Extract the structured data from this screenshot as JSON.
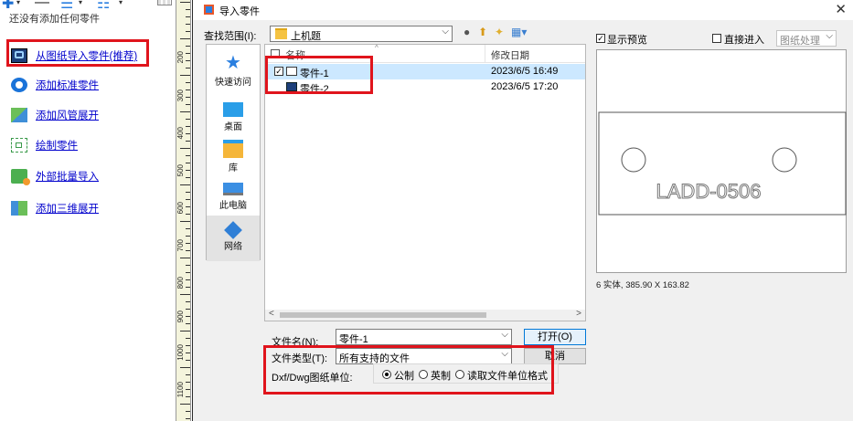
{
  "left_panel": {
    "no_parts_text": "还没有添加任何零件",
    "actions": [
      {
        "label": "从图纸导入零件(推荐)",
        "icon": "import-from-drawing-icon"
      },
      {
        "label": "添加标准零件",
        "icon": "standard-part-icon"
      },
      {
        "label": "添加风管展开",
        "icon": "duct-unfold-icon"
      },
      {
        "label": "绘制零件",
        "icon": "draw-part-icon"
      },
      {
        "label": "外部批量导入",
        "icon": "batch-import-icon"
      },
      {
        "label": "添加三维展开",
        "icon": "3d-unfold-icon"
      }
    ]
  },
  "ruler": {
    "labels": [
      "200",
      "300",
      "400",
      "500",
      "600",
      "700",
      "800",
      "900",
      "1000",
      "1100"
    ]
  },
  "dialog": {
    "title": "导入零件",
    "look_in_label": "查找范围(I):",
    "look_in_value": "上机题",
    "places": [
      {
        "label": "快速访问",
        "icon": "quick-access-icon"
      },
      {
        "label": "桌面",
        "icon": "desktop-icon"
      },
      {
        "label": "库",
        "icon": "library-icon"
      },
      {
        "label": "此电脑",
        "icon": "this-pc-icon"
      },
      {
        "label": "网络",
        "icon": "network-icon"
      }
    ],
    "columns": {
      "name": "名称",
      "modified": "修改日期"
    },
    "files": [
      {
        "name": "零件-1",
        "date": "2023/6/5 16:49",
        "checked": true,
        "selected": true
      },
      {
        "name": "零件-2",
        "date": "2023/6/5 17:20",
        "checked": false,
        "selected": false
      }
    ],
    "filename_label": "文件名(N):",
    "filename_value": "零件-1",
    "filetype_label": "文件类型(T):",
    "filetype_value": "所有支持的文件",
    "open_button": "打开(O)",
    "cancel_button": "取消",
    "units_label": "Dxf/Dwg图纸单位:",
    "units_options": [
      "公制",
      "英制",
      "读取文件单位格式"
    ],
    "units_selected": 0,
    "show_preview_label": "显示预览",
    "show_preview_checked": true,
    "direct_enter_label": "直接进入",
    "direct_enter_checked": false,
    "drawing_type_value": "图纸处理",
    "preview_text": "LADD-0506",
    "preview_info": "6 实体, 385.90 X 163.82"
  },
  "colors": {
    "highlight": "#e0141c",
    "link": "#0000cc",
    "selection": "#cce8ff"
  }
}
